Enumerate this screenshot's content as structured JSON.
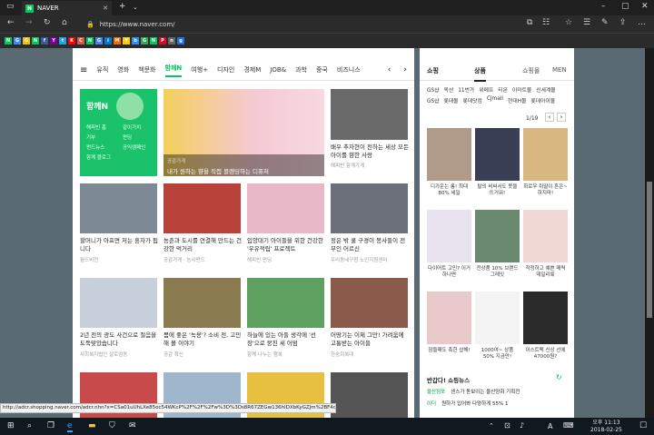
{
  "browser": {
    "tab_title": "NAVER",
    "url": "https://www.naver.com/",
    "favorites": [
      {
        "label": "N",
        "color": "#03c75a"
      },
      {
        "label": "G",
        "color": "#4285f4"
      },
      {
        "label": "G",
        "color": "#fbbc05"
      },
      {
        "label": "N",
        "color": "#03c75a"
      },
      {
        "label": "f",
        "color": "#3b5998"
      },
      {
        "label": "Y",
        "color": "#7b0099"
      },
      {
        "label": "t",
        "color": "#1da1f2"
      },
      {
        "label": "K",
        "color": "#ff0000"
      },
      {
        "label": "C",
        "color": "#d9534f"
      },
      {
        "label": "N",
        "color": "#03c75a"
      },
      {
        "label": "G",
        "color": "#4285f4"
      },
      {
        "label": "i",
        "color": "#0078d7"
      },
      {
        "label": "M",
        "color": "#ff6600"
      },
      {
        "label": "Y",
        "color": "#ffcc00"
      },
      {
        "label": "b",
        "color": "#2d8cff"
      },
      {
        "label": "G",
        "color": "#34a853"
      },
      {
        "label": "N",
        "color": "#03c75a"
      },
      {
        "label": "P",
        "color": "#e60023"
      },
      {
        "label": "n",
        "color": "#666666"
      },
      {
        "label": "g",
        "color": "#1a73e8"
      }
    ]
  },
  "naver": {
    "categories": [
      "유직",
      "영화",
      "책문화",
      "함께N",
      "여행+",
      "디자인",
      "경제M",
      "JOB&",
      "과학",
      "중국",
      "비즈니스"
    ],
    "active_category": "함께N",
    "feature": {
      "title": "함께N",
      "links": [
        "해피빈 홈",
        "같이가치",
        "기부",
        "펀딩",
        "펀드뉴스",
        "공익캠페인",
        "함께 블로그"
      ]
    },
    "highlight": {
      "tag": "공감가게",
      "caption": "내가 원하는 향을 직접 블렌딩하는 디퓨저"
    },
    "side_story": {
      "caption": "배우 추자현이 전하는 세상 모든 아이를 향한 사랑",
      "source": "해피빈 함께가게"
    },
    "cards": [
      {
        "caption": "할머니가 아프면 저는 혼자가 됩니다",
        "source": "월드비전",
        "color": "#7d8a96"
      },
      {
        "caption": "농촌과 도시를 연결해 만드는 건강한 먹거리",
        "source": "공감가게 · 농사펀드",
        "color": "#b8423a"
      },
      {
        "caption": "입양대기 아이들을 위한 건강한 '우유적립' 프로젝트",
        "source": "해피빈 펀딩",
        "color": "#e8b8c8"
      },
      {
        "caption": "정은 밖 쿨 구경이 봉사들이 전부인 어르신",
        "source": "우리동네구청 노인지원센터",
        "color": "#6a6f7a"
      },
      {
        "caption": "2년 전의 광도 사건으로 절음을 도둑맞았습니다",
        "source": "사회복지법인 샬로엄동",
        "color": "#c8d0dc"
      },
      {
        "caption": "몸에 좋은 '녹용'? 소비 전, 고민해 볼 이야기",
        "source": "공감 확신",
        "color": "#8a7a50"
      },
      {
        "caption": "하늘에 있는 아들 생각에 '선장'으로 뭉친 세 어멈",
        "source": "함께 나누는 행복",
        "color": "#5ea060"
      },
      {
        "caption": "어땅기는 이제 그만! 가려움에 고통받는 아이들",
        "source": "한숨회복대",
        "color": "#8a5a4a"
      }
    ],
    "bottom_colors": [
      "#c84a4a",
      "#9fb6cc",
      "#e8c040",
      "#555555"
    ]
  },
  "shopping": {
    "title": "쇼핑",
    "tabs": [
      "상품",
      "쇼핑몰",
      "MEN"
    ],
    "keywords": [
      "GS샵",
      "옥션",
      "11번가",
      "위메프",
      "티몬",
      "이마트몰",
      "신세계몰",
      "GS샵",
      "롯데몰",
      "롯데닷컴",
      "CJmall",
      "현대H몰",
      "롯데아이몰"
    ],
    "page": "1/19",
    "items": [
      {
        "caption": "디가운는 롱! 최대 80% 세일",
        "color": "#b09a8a"
      },
      {
        "caption": "탈의 비싸서도 못을 뜨거워!",
        "color": "#3a3f55"
      },
      {
        "caption": "화로우 쥐딸이 흔은~하지마!",
        "color": "#d8b880"
      },
      {
        "caption": "다이어트 고민? 이거 하나면",
        "color": "#e9e3f0"
      },
      {
        "caption": "전상품 10% 브랜드 그레잇",
        "color": "#6a8a70"
      },
      {
        "caption": "작정하고 예쁜 매력 데일리룩",
        "color": "#f0d8d4"
      },
      {
        "caption": "잠들때도 촉한 샵해!",
        "color": "#e8c8c8"
      },
      {
        "caption": "1000여~ 상품 50% 지금만!",
        "color": "#f4f4f4"
      },
      {
        "caption": "이스트팩 신상 선에 47000원?",
        "color": "#2a2a2a"
      }
    ],
    "news_title": "반갑다! 쇼핑뉴스",
    "news": [
      {
        "tag": "울산점포",
        "text": "센스가 돋보이는 울산양화 기획전"
      },
      {
        "tag": "이더",
        "text": "원하가 입어봐 다양하게 55% 1"
      }
    ]
  },
  "status_url": "http://adcr.shopping.naver.com/adcr.nhn?x=CSa01uUhLXe85oc54WKcP%2F%2F%2Fw%3D%3Ds8R67ZEGw136hlDXbKyGZJm%2BF4cqZNH",
  "taskbar": {
    "time": "오후 11:13",
    "date": "2018-02-25",
    "lang": "A"
  }
}
